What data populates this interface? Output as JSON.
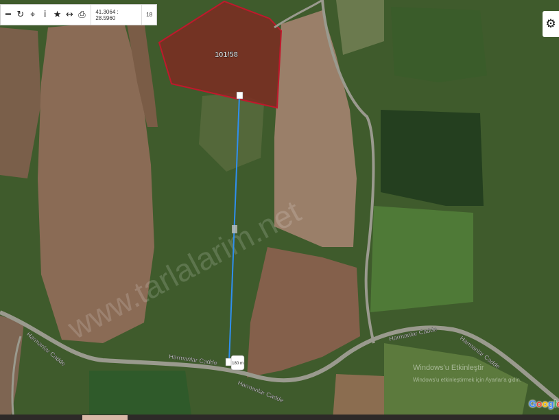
{
  "toolbar": {
    "buttons": [
      {
        "name": "minus-icon",
        "glyph": "━"
      },
      {
        "name": "refresh-icon",
        "glyph": "↻"
      },
      {
        "name": "locate-icon",
        "glyph": "⌖"
      },
      {
        "name": "info-icon",
        "glyph": "i"
      },
      {
        "name": "star-icon",
        "glyph": "★"
      },
      {
        "name": "measure-icon",
        "glyph": "↔"
      },
      {
        "name": "print-icon",
        "glyph": "⎙"
      }
    ],
    "coordinates": "41.3064 : 28.5960",
    "zoom": "18"
  },
  "settings": {
    "icon": "gear-icon",
    "glyph": "⚙"
  },
  "parcel": {
    "label": "101/58",
    "outline_color": "#c0182c"
  },
  "measurement": {
    "distance_label": "180 m",
    "line_color": "#2f8ff0"
  },
  "roads": [
    {
      "label": "Harmanlar Cadde"
    },
    {
      "label": "Harmanlar Cadde"
    },
    {
      "label": "Harmanlar Cadde"
    },
    {
      "label": "Harmanlar Cadde"
    },
    {
      "label": "Harmanlar Cadde"
    }
  ],
  "watermarks": {
    "site": "www.tarlalarim.net",
    "windows_title": "Windows'u Etkinleştir",
    "windows_sub": "Windows'u etkinleştirmek için Ayarlar'a gidin."
  },
  "attribution": {
    "letters": [
      {
        "ch": "G",
        "color": "#4285f4"
      },
      {
        "ch": "o",
        "color": "#ea4335"
      },
      {
        "ch": "o",
        "color": "#fbbc05"
      },
      {
        "ch": "g",
        "color": "#4285f4"
      },
      {
        "ch": "l",
        "color": "#34a853"
      },
      {
        "ch": "e",
        "color": "#ea4335"
      }
    ]
  }
}
